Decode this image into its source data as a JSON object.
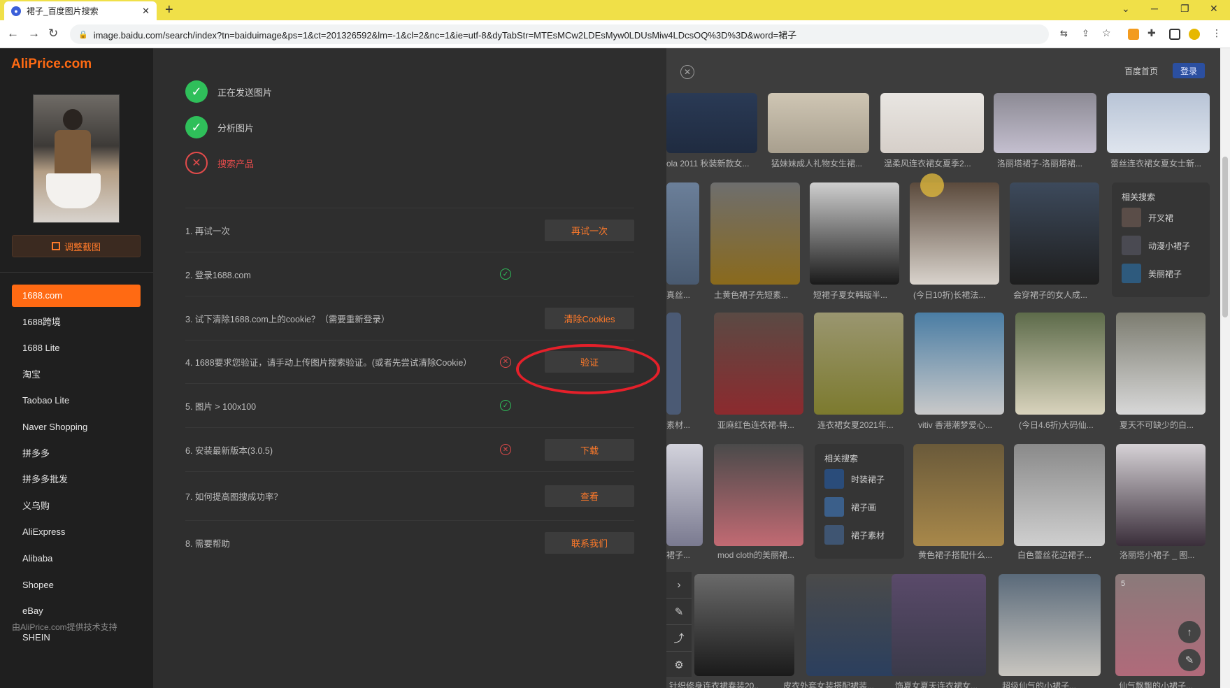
{
  "browser": {
    "tab_title": "裙子_百度图片搜索",
    "tab_close": "✕",
    "new_tab": "+",
    "url": "image.baidu.com/search/index?tn=baiduimage&ps=1&ct=201326592&lm=-1&cl=2&nc=1&ie=utf-8&dyTabStr=MTEsMCw2LDEsMyw0LDUsMiw4LDcsOQ%3D%3D&word=裙子"
  },
  "aliprice": {
    "logo": "AliPrice.com",
    "adjust_button": "调整截图",
    "platforms": [
      "1688.com",
      "1688跨境",
      "1688 Lite",
      "淘宝",
      "Taobao Lite",
      "Naver Shopping",
      "拼多多",
      "拼多多批发",
      "义乌购",
      "AliExpress",
      "Alibaba",
      "Shopee",
      "eBay",
      "SHEIN"
    ],
    "footer": "由AliPrice.com提供技术支持",
    "steps": [
      {
        "label": "正在发送图片",
        "state": "ok"
      },
      {
        "label": "分析图片",
        "state": "ok"
      },
      {
        "label": "搜索产品",
        "state": "fail"
      }
    ],
    "checklist": [
      {
        "text": "1. 再试一次",
        "status": "",
        "action": "再试一次"
      },
      {
        "text": "2. 登录1688.com",
        "status": "good",
        "action": ""
      },
      {
        "text": "3. 试下清除1688.com上的cookie？（需要重新登录）",
        "status": "",
        "action": "清除Cookies"
      },
      {
        "text": "4. 1688要求您验证，请手动上传图片搜索验证。(或者先尝试清除Cookie）",
        "status": "bad",
        "action": "验证"
      },
      {
        "text": "5. 图片 > 100x100",
        "status": "good",
        "action": ""
      },
      {
        "text": "6. 安装最新版本(3.0.5)",
        "status": "bad",
        "action": "下载"
      },
      {
        "text": "7. 如何提高图搜成功率？",
        "status": "",
        "action": "查看"
      },
      {
        "text": "8. 需要帮助",
        "status": "",
        "action": "联系我们"
      }
    ]
  },
  "baidu": {
    "home_link": "百度首页",
    "login": "登录",
    "related_title": "相关搜索",
    "related_a": [
      "开叉裙",
      "动漫小裙子",
      "美丽裙子"
    ],
    "related_b": [
      "时装裙子",
      "裙子画",
      "裙子素材"
    ],
    "captions": {
      "r1": [
        "ola 2011 秋装新款女...",
        "猛妹妹成人礼物女生裙...",
        "温柔风连衣裙女夏季2...",
        "洛丽塔裙子-洛丽塔裙...",
        "蕾丝连衣裙女夏女士新..."
      ],
      "r2": [
        "真丝...",
        "土黄色裙子先短素...",
        "短裙子夏女韩版半...",
        "(今日10折)长裙法...",
        "会穿裙子的女人成..."
      ],
      "r3": [
        "素材...",
        "亚麻红色连衣裙-特...",
        "连衣裙女夏2021年...",
        "vitiv 香港潮梦爱心...",
        "(今日4.6折)大码仙...",
        "夏天不可缺少的白..."
      ],
      "r4": [
        "裙子...",
        "mod cloth的美丽裙...",
        "黄色裙子搭配什么...",
        "白色蕾丝花边裙子...",
        "洛丽塔小裙子 _ 图..."
      ],
      "r5": [
        "针织修身连衣裙春装20...",
        "皮衣外套女装搭配裙装...",
        "饰夏女夏天连衣裙女...",
        "超级仙气的小裙子...",
        "仙气飘飘的小裙子..."
      ]
    },
    "badge_count": "5"
  },
  "colors": {
    "accent": "#ff6a13",
    "success": "#2fbf5a",
    "error": "#e34b4b",
    "annotation": "#e5202a"
  }
}
